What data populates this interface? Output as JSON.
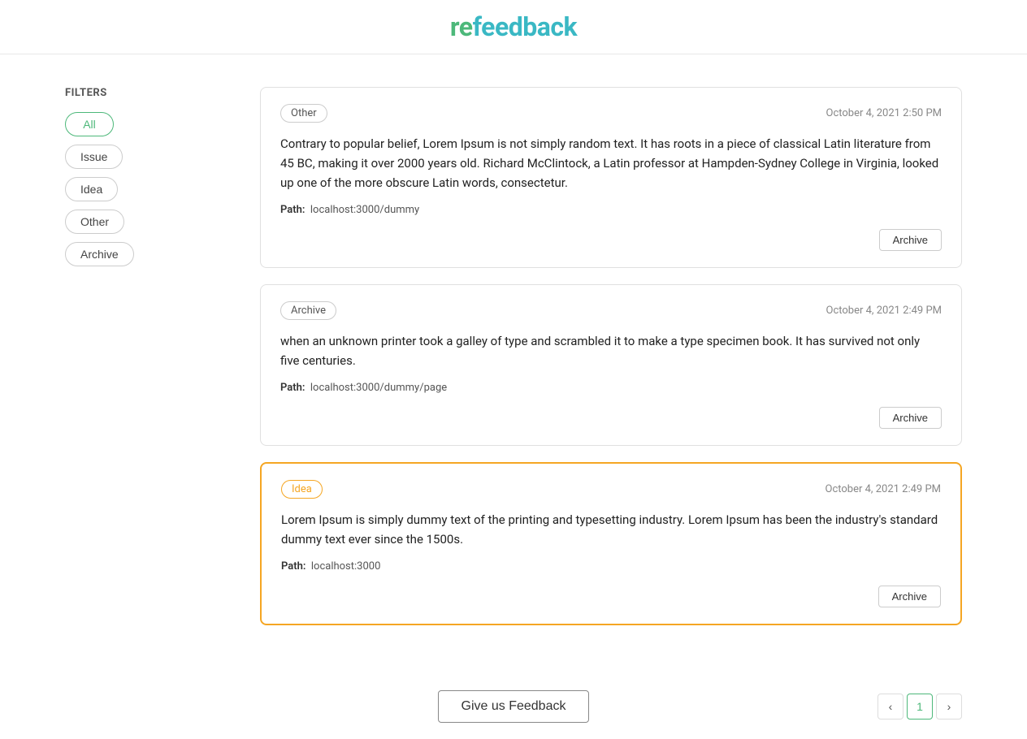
{
  "header": {
    "logo_re": "re",
    "logo_feedback": "feedback"
  },
  "sidebar": {
    "filters_title": "FILTERS",
    "buttons": [
      {
        "label": "All",
        "active": true
      },
      {
        "label": "Issue",
        "active": false
      },
      {
        "label": "Idea",
        "active": false
      },
      {
        "label": "Other",
        "active": false
      },
      {
        "label": "Archive",
        "active": false
      }
    ]
  },
  "cards": [
    {
      "tag": "Other",
      "tag_type": "other",
      "timestamp": "October 4, 2021 2:50 PM",
      "body": "Contrary to popular belief, Lorem Ipsum is not simply random text. It has roots in a piece of classical Latin literature from 45 BC, making it over 2000 years old. Richard McClintock, a Latin professor at Hampden-Sydney College in Virginia, looked up one of the more obscure Latin words, consectetur.",
      "path_label": "Path:",
      "path": "localhost:3000/dummy",
      "archive_label": "Archive",
      "highlighted": false
    },
    {
      "tag": "Archive",
      "tag_type": "archive",
      "timestamp": "October 4, 2021 2:49 PM",
      "body": "when an unknown printer took a galley of type and scrambled it to make a type specimen book. It has survived not only five centuries.",
      "path_label": "Path:",
      "path": "localhost:3000/dummy/page",
      "archive_label": "Archive",
      "highlighted": false
    },
    {
      "tag": "Idea",
      "tag_type": "idea",
      "timestamp": "October 4, 2021 2:49 PM",
      "body": "Lorem Ipsum is simply dummy text of the printing and typesetting industry. Lorem Ipsum has been the industry's standard dummy text ever since the 1500s.",
      "path_label": "Path:",
      "path": "localhost:3000",
      "archive_label": "Archive",
      "highlighted": true
    }
  ],
  "bottom": {
    "give_feedback_label": "Give us Feedback"
  },
  "pagination": {
    "prev_label": "‹",
    "current_page": "1",
    "next_label": "›"
  }
}
